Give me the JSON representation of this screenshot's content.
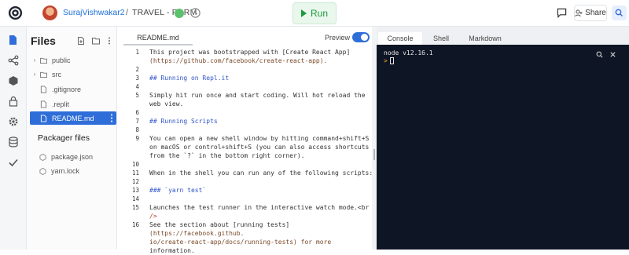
{
  "topbar": {
    "username": "SurajVishwakar2",
    "separator": "/",
    "project": "TRAVEL - FORM",
    "run_label": "Run",
    "share_label": "Share",
    "colors": {
      "run_bg": "#e9f7ec",
      "run_text": "#1f9a3a",
      "link": "#1e6fd9"
    }
  },
  "sidebar_rail": {
    "icons": [
      "files-icon",
      "share-network-icon",
      "packages-icon",
      "lock-icon",
      "settings-icon",
      "database-icon",
      "check-icon"
    ]
  },
  "files_panel": {
    "title": "Files",
    "items": [
      {
        "name": "public",
        "type": "folder"
      },
      {
        "name": "src",
        "type": "folder"
      },
      {
        "name": ".gitignore",
        "type": "file"
      },
      {
        "name": ".replit",
        "type": "file"
      },
      {
        "name": "README.md",
        "type": "file",
        "selected": true
      }
    ],
    "packager_title": "Packager files",
    "packager_items": [
      "package.json",
      "yarn.lock"
    ],
    "colors": {
      "selected": "#2f6ed8"
    }
  },
  "editor": {
    "tab": "README.md",
    "preview_label": "Preview",
    "preview_on": true,
    "lines": [
      {
        "n": "1",
        "text": "This project was bootstrapped with [Create React App]",
        "style": ""
      },
      {
        "n": "",
        "text": "(https://github.com/facebook/create-react-app).",
        "style": "link"
      },
      {
        "n": "2",
        "text": "",
        "style": ""
      },
      {
        "n": "3",
        "text": "## Running on Repl.it",
        "style": "md"
      },
      {
        "n": "4",
        "text": "",
        "style": ""
      },
      {
        "n": "5",
        "text": "Simply hit run once and start coding. Will hot reload the",
        "style": ""
      },
      {
        "n": "",
        "text": "web view.",
        "style": ""
      },
      {
        "n": "6",
        "text": "",
        "style": ""
      },
      {
        "n": "7",
        "text": "## Running Scripts",
        "style": "md"
      },
      {
        "n": "8",
        "text": "",
        "style": ""
      },
      {
        "n": "9",
        "text": "You can open a new shell window by hitting command+shift+S",
        "style": ""
      },
      {
        "n": "",
        "text": "on macOS or control+shift+S (you can also access shortcuts",
        "style": ""
      },
      {
        "n": "",
        "text": "from the `?` in the bottom right corner).",
        "style": ""
      },
      {
        "n": "10",
        "text": "",
        "style": ""
      },
      {
        "n": "11",
        "text": "When in the shell you can run any of the following scripts:",
        "style": ""
      },
      {
        "n": "12",
        "text": "",
        "style": ""
      },
      {
        "n": "13",
        "text": "### `yarn test`",
        "style": "md"
      },
      {
        "n": "14",
        "text": "",
        "style": ""
      },
      {
        "n": "15",
        "text": "Launches the test runner in the interactive watch mode.<br",
        "style": ""
      },
      {
        "n": "",
        "text": "/>",
        "style": "tag"
      },
      {
        "n": "16",
        "text": "See the section about [running tests]",
        "style": ""
      },
      {
        "n": "",
        "text": "(https://facebook.github.",
        "style": "link"
      },
      {
        "n": "",
        "text": "io/create-react-app/docs/running-tests) for more",
        "style": "link"
      },
      {
        "n": "",
        "text": "information.",
        "style": ""
      }
    ]
  },
  "right_panel": {
    "tabs": [
      "Console",
      "Shell",
      "Markdown"
    ],
    "active_tab": "Console",
    "console_lines": [
      "node v12.16.1"
    ],
    "prompt": ">",
    "colors": {
      "console_bg": "#0e1525",
      "prompt": "#f5a623"
    }
  }
}
